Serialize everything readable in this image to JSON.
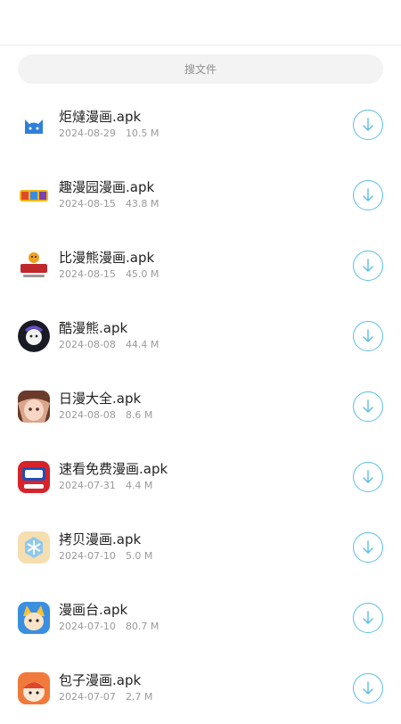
{
  "search": {
    "placeholder": "搜文件"
  },
  "files": [
    {
      "name": "炬燵漫画.apk",
      "date": "2024-08-29",
      "size": "10.5 M",
      "icon": "blue-cat-icon"
    },
    {
      "name": "趣漫园漫画.apk",
      "date": "2024-08-15",
      "size": "43.8 M",
      "icon": "qumanyuan-logo-icon"
    },
    {
      "name": "比漫熊漫画.apk",
      "date": "2024-08-15",
      "size": "45.0 M",
      "icon": "bimanxiong-logo-icon"
    },
    {
      "name": "酷漫熊.apk",
      "date": "2024-08-08",
      "size": "44.4 M",
      "icon": "kumanxiong-avatar-icon"
    },
    {
      "name": "日漫大全.apk",
      "date": "2024-08-08",
      "size": "8.6 M",
      "icon": "anime-girl-icon"
    },
    {
      "name": "速看免费漫画.apk",
      "date": "2024-07-31",
      "size": "4.4 M",
      "icon": "sukan-manhua-icon"
    },
    {
      "name": "拷贝漫画.apk",
      "date": "2024-07-10",
      "size": "5.0 M",
      "icon": "kaobei-snowflake-icon"
    },
    {
      "name": "漫画台.apk",
      "date": "2024-07-10",
      "size": "80.7 M",
      "icon": "manhuatai-character-icon"
    },
    {
      "name": "包子漫画.apk",
      "date": "2024-07-07",
      "size": "2.7 M",
      "icon": "baozi-character-icon"
    }
  ],
  "colors": {
    "accent": "#5bbde4",
    "search_bg": "#f3f3f3",
    "text": "#222222",
    "meta": "#9a9a9a"
  }
}
